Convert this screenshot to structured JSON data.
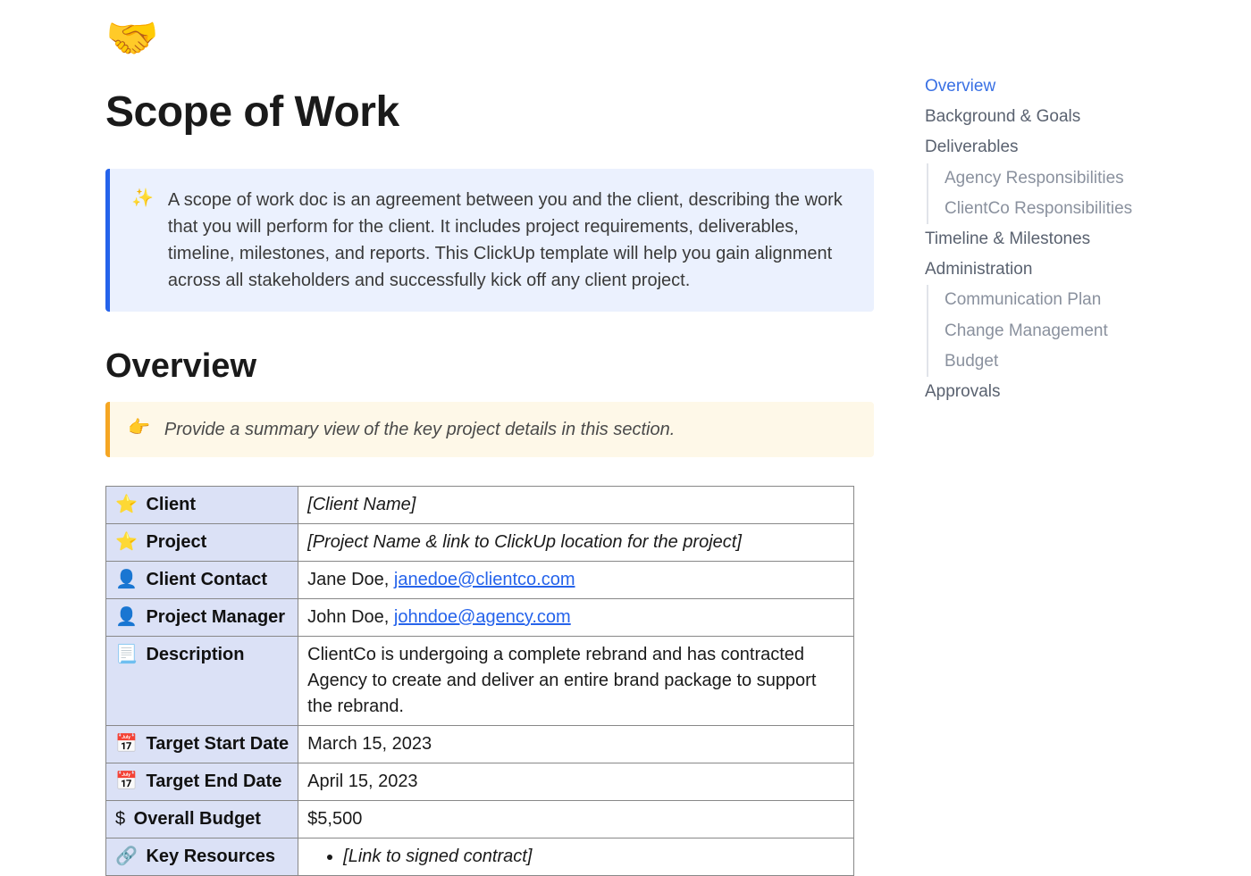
{
  "doc": {
    "icon": "🤝",
    "title": "Scope of Work"
  },
  "intro_callout": {
    "icon": "✨",
    "text": "A scope of work doc is an agreement between you and the client, describing the work that you will perform for the client. It includes project requirements, deliverables, timeline, milestones, and reports. This ClickUp template will help you gain alignment across all stakeholders and successfully kick off any client project."
  },
  "overview": {
    "heading": "Overview",
    "tip_icon": "👉",
    "tip_text": "Provide a summary view of the key project details in this section."
  },
  "table": {
    "rows": [
      {
        "icon": "⭐",
        "label": "Client",
        "value": "[Client Name]",
        "italic": true
      },
      {
        "icon": "⭐",
        "label": "Project",
        "value": "[Project Name & link to ClickUp location for the project]",
        "italic": true
      },
      {
        "icon": "👤",
        "label": "Client Contact",
        "prefix": "Jane Doe, ",
        "link": "janedoe@clientco.com"
      },
      {
        "icon": "👤",
        "label": "Project Manager",
        "prefix": "John Doe, ",
        "link": "johndoe@agency.com"
      },
      {
        "icon": "📃",
        "label": "Description",
        "value": "ClientCo is undergoing a complete rebrand and has contracted Agency to create and deliver an entire brand package to support the rebrand."
      },
      {
        "icon": "📅",
        "label": "Target Start Date",
        "value": "March 15, 2023"
      },
      {
        "icon": "📅",
        "label": "Target End Date",
        "value": "April 15, 2023"
      },
      {
        "icon": "$",
        "label": "Overall Budget",
        "value": "$5,500"
      },
      {
        "icon": "🔗",
        "label": "Key Resources",
        "bullets": [
          "[Link to signed contract]"
        ]
      }
    ]
  },
  "toc": [
    {
      "label": "Overview",
      "active": true
    },
    {
      "label": "Background & Goals"
    },
    {
      "label": "Deliverables",
      "children": [
        "Agency Responsibilities",
        "ClientCo Responsibilities"
      ]
    },
    {
      "label": "Timeline & Milestones"
    },
    {
      "label": "Administration",
      "children": [
        "Communication Plan",
        "Change Management",
        "Budget"
      ]
    },
    {
      "label": "Approvals"
    }
  ]
}
